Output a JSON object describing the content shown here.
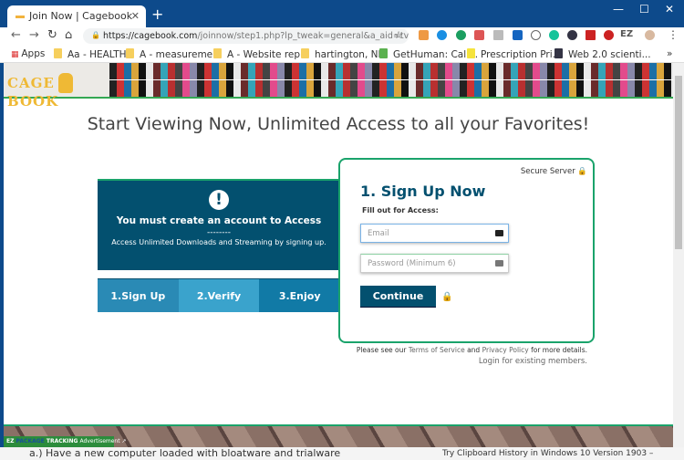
{
  "browser": {
    "tab_title": "Join Now | Cagebook",
    "tab_close": "✕",
    "new_tab": "+",
    "url_domain": "https://cagebook.com",
    "url_path": "/joinnow/step1.php?lp_tweak=general&a_aid=tvnce&da...",
    "bookmarks": [
      "Apps",
      "Aa - HEALTH",
      "A - measureme...",
      "A - Website rep...",
      "hartington, NE",
      "GetHuman: Call...",
      "Prescription Pri...",
      "Web 2.0 scienti..."
    ],
    "more_bookmarks": "»",
    "profile_ext": "EZ"
  },
  "site": {
    "logo_left": "CAGE",
    "logo_right": "BOOK",
    "heading": "Start Viewing Now, Unlimited Access to all your Favorites!",
    "notice": {
      "icon": "!",
      "title": "You must create an account to Access",
      "dashes": "--------",
      "subtitle": "Access Unlimited Downloads and Streaming by signing up."
    },
    "steps": [
      {
        "label": "1.Sign Up",
        "color": "#2a8ab5"
      },
      {
        "label": "2.Verify",
        "color": "#3aa3cc"
      },
      {
        "label": "3.Enjoy",
        "color": "#117aa6"
      }
    ],
    "form": {
      "secure": "Secure Server",
      "title": "1. Sign Up Now",
      "subtitle": "Fill out for Access:",
      "email_placeholder": "Email",
      "password_placeholder": "Password (Minimum 6)",
      "submit": "Continue"
    },
    "terms": {
      "pre": "Please see our",
      "tos": "Terms of Service",
      "and": "and",
      "privacy": "Privacy Policy",
      "post": "for more details."
    },
    "login": "Login for existing members."
  },
  "ad": {
    "ez": "EZ",
    "package": "PACKAGE",
    "tracking": "TRACKING",
    "label": "Advertisement ↗"
  },
  "underlying": {
    "left": "a.) Have a new computer loaded with bloatware and trialware",
    "right": "Try Clipboard History in Windows 10 Version 1903 –"
  },
  "colors": {
    "brand_dark": "#03506f",
    "accent_green": "#1aa36b",
    "logo_gold": "#efb935"
  }
}
